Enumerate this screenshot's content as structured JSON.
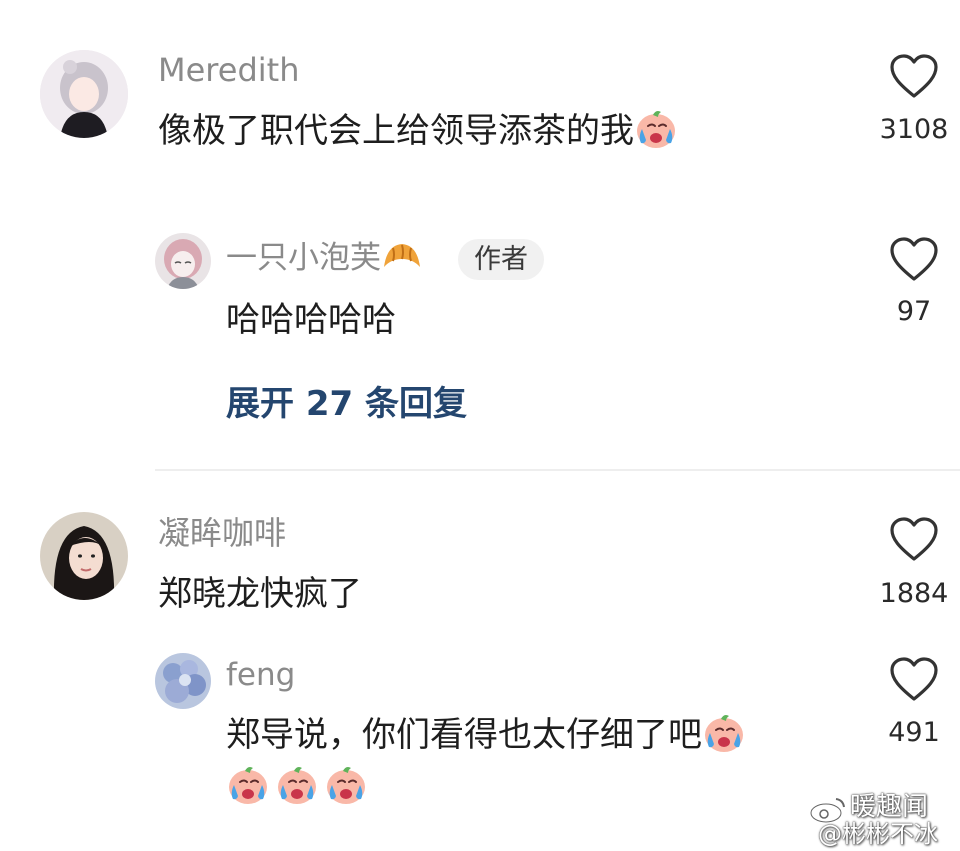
{
  "comments": [
    {
      "username": "Meredith",
      "text": "像极了职代会上给领导添茶的我",
      "likes": "3108",
      "replies": [
        {
          "username": "一只小泡芙",
          "badge": "作者",
          "text": "哈哈哈哈哈",
          "likes": "97"
        }
      ],
      "expand_label": "展开 27 条回复"
    },
    {
      "username": "凝眸咖啡",
      "text": "郑晓龙快疯了",
      "likes": "1884",
      "replies": [
        {
          "username": "feng",
          "text": "郑导说，你们看得也太仔细了吧",
          "likes": "491"
        }
      ]
    }
  ],
  "watermark": {
    "line1": "暖趣闻",
    "line2": "@彬彬不冰"
  },
  "icons": {
    "like": "heart-outline-icon",
    "crying_emoji": "crying-face-icon",
    "croissant": "croissant-icon",
    "weibo": "weibo-logo-icon"
  }
}
